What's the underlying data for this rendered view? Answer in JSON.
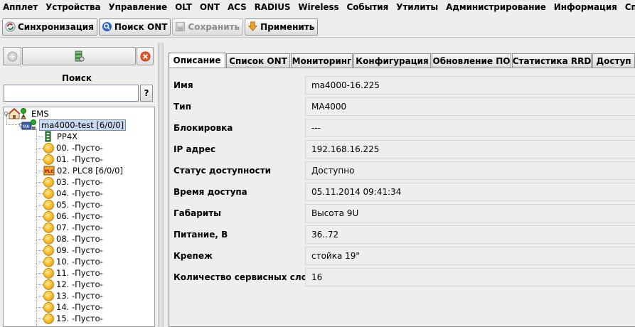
{
  "menu": [
    "Апплет",
    "Устройства",
    "Управление",
    "OLT",
    "ONT",
    "ACS",
    "RADIUS",
    "Wireless",
    "События",
    "Утилиты",
    "Администрирование",
    "Информация",
    "Справка"
  ],
  "toolbar": {
    "sync": {
      "label": "Синхронизация",
      "icon": "sync-icon"
    },
    "search_ont": {
      "label": "Поиск ONT",
      "icon": "magnifier-icon"
    },
    "save": {
      "label": "Сохранить",
      "icon": "floppy-disk-icon"
    },
    "apply": {
      "label": "Применить",
      "icon": "apply-arrow-icon"
    }
  },
  "left": {
    "search_title": "Поиск",
    "search_value": "",
    "help_label": "?",
    "tree": {
      "root": "EMS",
      "device": "ma4000-test [6/0/0]",
      "children": [
        {
          "label": "PP4X",
          "icon": "board-icon"
        },
        {
          "label": "00. -Пусто-",
          "icon": "empty-slot-icon"
        },
        {
          "label": "01. -Пусто-",
          "icon": "empty-slot-icon"
        },
        {
          "label": "02. PLC8 [6/0/0]",
          "icon": "plc-card-icon"
        },
        {
          "label": "03. -Пусто-",
          "icon": "empty-slot-icon"
        },
        {
          "label": "04. -Пусто-",
          "icon": "empty-slot-icon"
        },
        {
          "label": "05. -Пусто-",
          "icon": "empty-slot-icon"
        },
        {
          "label": "06. -Пусто-",
          "icon": "empty-slot-icon"
        },
        {
          "label": "07. -Пусто-",
          "icon": "empty-slot-icon"
        },
        {
          "label": "08. -Пусто-",
          "icon": "empty-slot-icon"
        },
        {
          "label": "09. -Пусто-",
          "icon": "empty-slot-icon"
        },
        {
          "label": "10. -Пусто-",
          "icon": "empty-slot-icon"
        },
        {
          "label": "11. -Пусто-",
          "icon": "empty-slot-icon"
        },
        {
          "label": "12. -Пусто-",
          "icon": "empty-slot-icon"
        },
        {
          "label": "13. -Пусто-",
          "icon": "empty-slot-icon"
        },
        {
          "label": "14. -Пусто-",
          "icon": "empty-slot-icon"
        },
        {
          "label": "15. -Пусто-",
          "icon": "empty-slot-icon"
        }
      ]
    }
  },
  "tabs": [
    {
      "label": "Описание",
      "active": true
    },
    {
      "label": "Список ONT",
      "active": false
    },
    {
      "label": "Мониторинг",
      "active": false
    },
    {
      "label": "Конфигурация",
      "active": false
    },
    {
      "label": "Обновление ПО",
      "active": false
    },
    {
      "label": "Статистика RRD",
      "active": false
    },
    {
      "label": "Доступ",
      "active": false
    }
  ],
  "properties": [
    {
      "label": "Имя",
      "value": "ma4000-16.225"
    },
    {
      "label": "Тип",
      "value": "MA4000"
    },
    {
      "label": "Блокировка",
      "value": "---"
    },
    {
      "label": "IP адрес",
      "value": "192.168.16.225"
    },
    {
      "label": "Статус доступности",
      "value": "Доступно"
    },
    {
      "label": "Время доступа",
      "value": "05.11.2014 09:41:34"
    },
    {
      "label": "Габариты",
      "value": "Высота 9U"
    },
    {
      "label": "Питание, В",
      "value": "36..72"
    },
    {
      "label": "Крепеж",
      "value": "стойка 19\""
    },
    {
      "label": "Количество сервисных слотов",
      "value": "16"
    }
  ],
  "colors": {
    "background": "#eeeeee",
    "selection": "#c9d9ee",
    "empty_slot": "#f9c02f",
    "status_ok": "#22aa22"
  }
}
